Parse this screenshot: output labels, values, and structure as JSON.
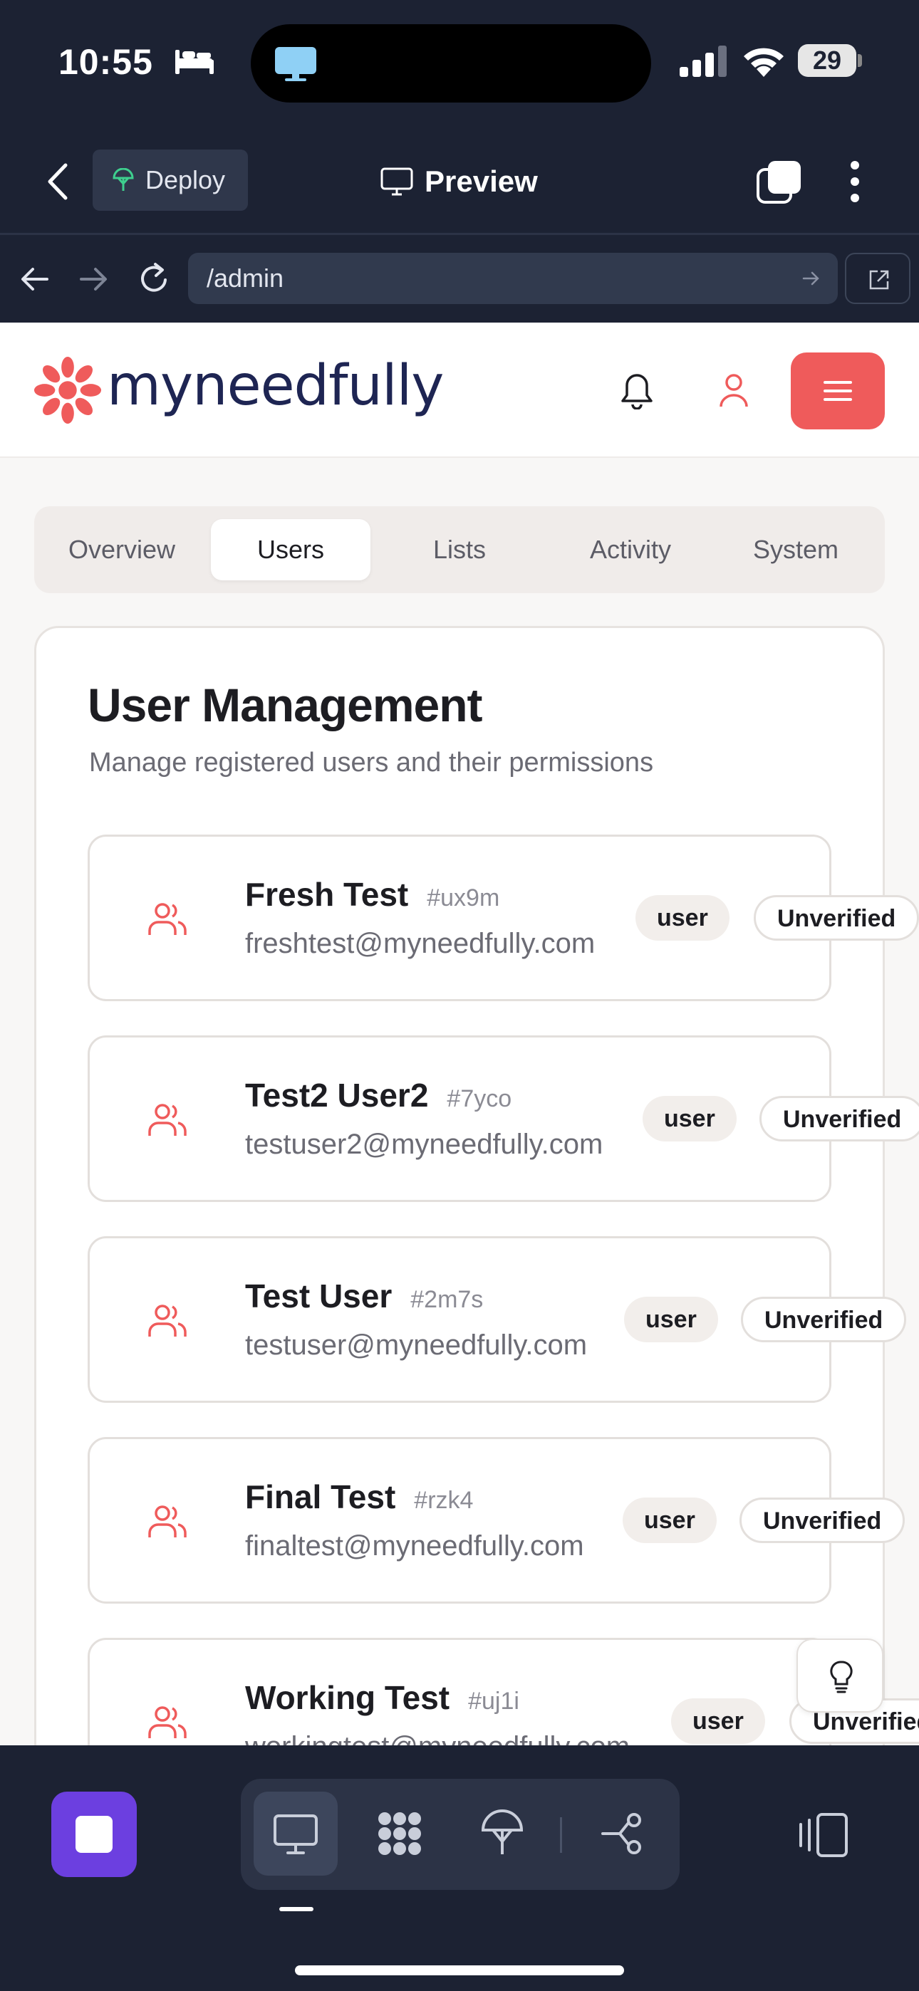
{
  "status_bar": {
    "time": "10:55",
    "battery": "29"
  },
  "toolbar": {
    "deploy_label": "Deploy",
    "preview_label": "Preview"
  },
  "browser": {
    "url": "/admin"
  },
  "site": {
    "logo_text": "myneedfully"
  },
  "tabs": [
    {
      "label": "Overview",
      "active": false
    },
    {
      "label": "Users",
      "active": true
    },
    {
      "label": "Lists",
      "active": false
    },
    {
      "label": "Activity",
      "active": false
    },
    {
      "label": "System",
      "active": false
    }
  ],
  "card": {
    "title": "User Management",
    "subtitle": "Manage registered users and their permissions"
  },
  "users": [
    {
      "name": "Fresh Test",
      "id": "#ux9m",
      "email": "freshtest@myneedfully.com",
      "role": "user",
      "status": "Unverified"
    },
    {
      "name": "Test2 User2",
      "id": "#7yco",
      "email": "testuser2@myneedfully.com",
      "role": "user",
      "status": "Unverified"
    },
    {
      "name": "Test User",
      "id": "#2m7s",
      "email": "testuser@myneedfully.com",
      "role": "user",
      "status": "Unverified"
    },
    {
      "name": "Final Test",
      "id": "#rzk4",
      "email": "finaltest@myneedfully.com",
      "role": "user",
      "status": "Unverified"
    },
    {
      "name": "Working Test",
      "id": "#uj1i",
      "email": "workingtest@myneedfully.com",
      "role": "user",
      "status": "Unverified"
    }
  ],
  "colors": {
    "accent": "#ef5b5b",
    "brand_navy": "#1e2553",
    "ide_bg": "#1c2233",
    "stop_purple": "#6c3fe0"
  },
  "icons": [
    "bed-icon",
    "monitor-icon",
    "signal-icon",
    "wifi-icon",
    "battery-icon",
    "back-chevron-icon",
    "deploy-icon",
    "preview-icon",
    "tabs-icon",
    "more-icon",
    "arrow-left-icon",
    "arrow-right-icon",
    "reload-icon",
    "external-link-icon",
    "bell-icon",
    "person-icon",
    "hamburger-icon",
    "users-icon",
    "lightbulb-icon",
    "stop-icon",
    "desktop-icon",
    "apps-icon",
    "deploy-tree-icon",
    "git-branch-icon",
    "layout-icon"
  ]
}
